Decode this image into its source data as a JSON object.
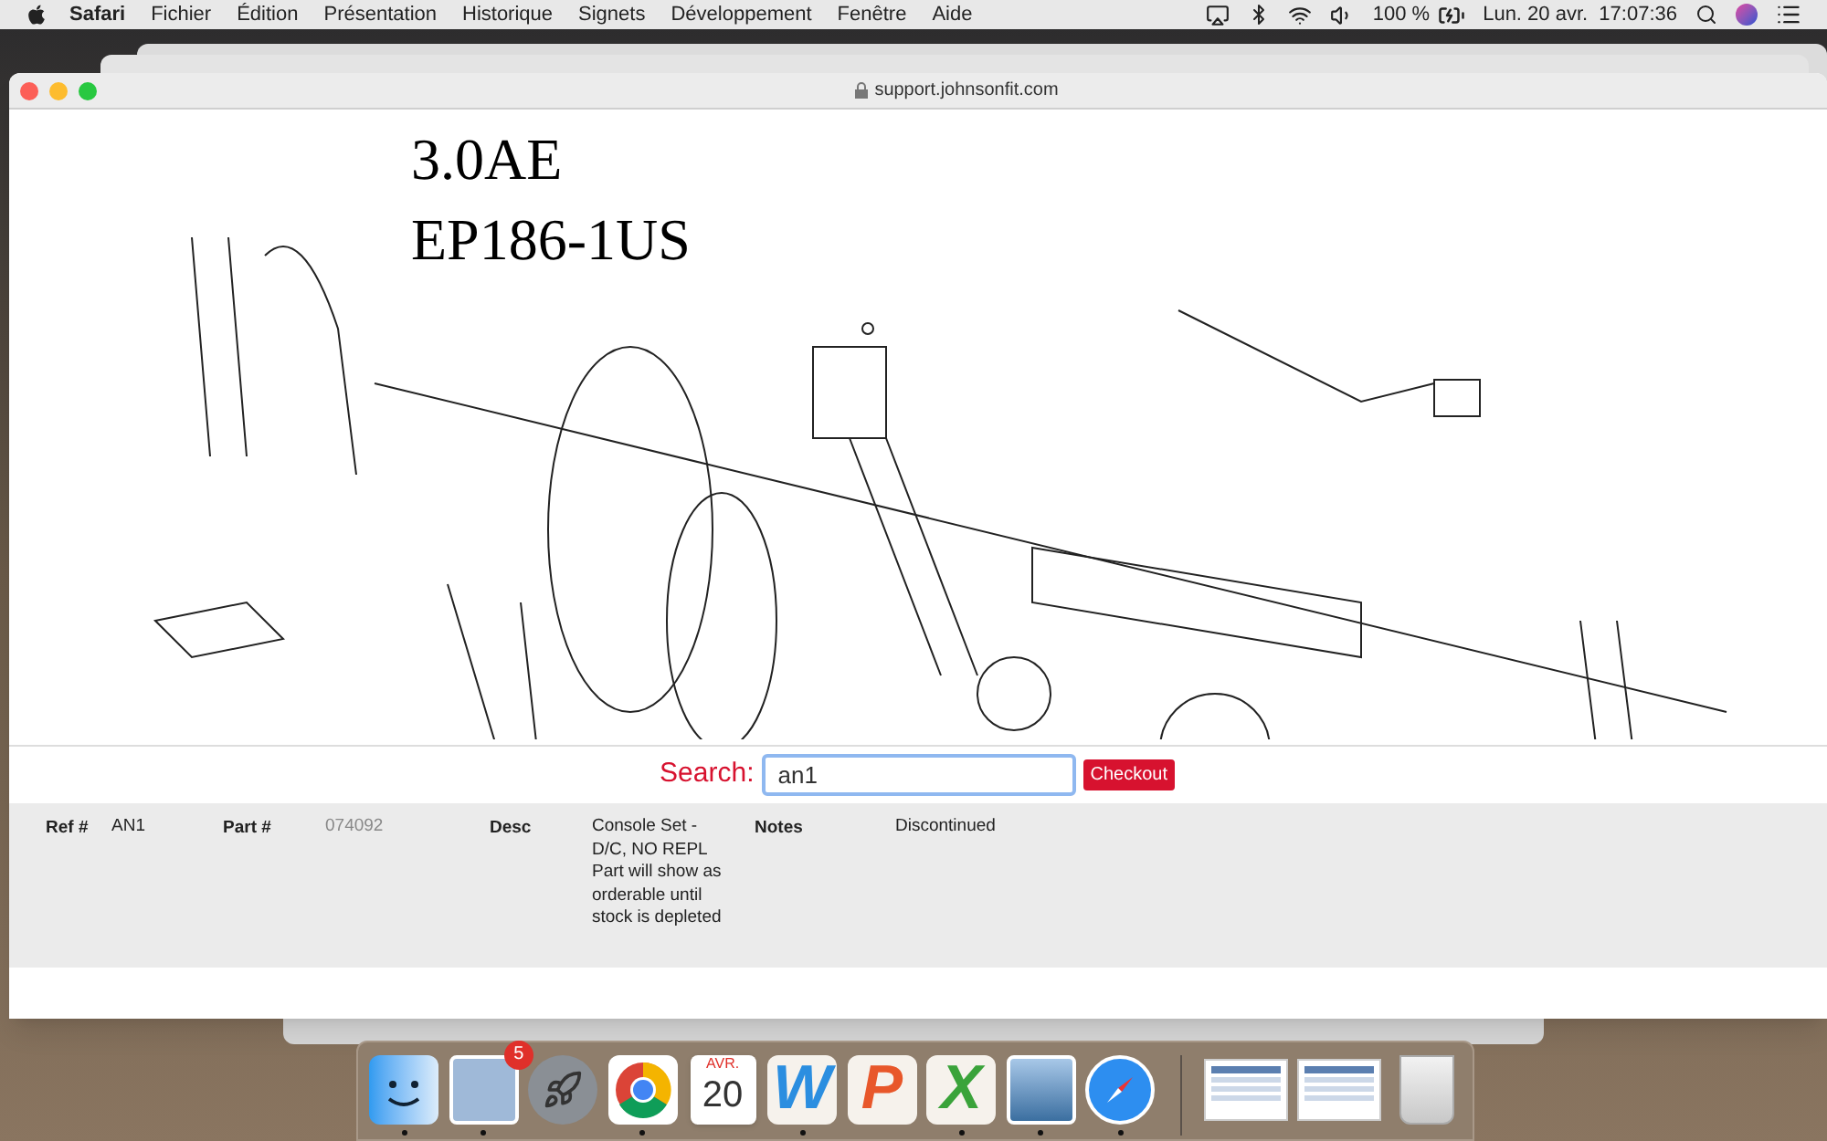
{
  "menu_bar": {
    "app": "Safari",
    "menus": [
      "Fichier",
      "Édition",
      "Présentation",
      "Historique",
      "Signets",
      "Développement",
      "Fenêtre",
      "Aide"
    ],
    "battery": "100 %",
    "clock": "Lun. 20 avr.  17:07:36"
  },
  "browser": {
    "url": "support.johnsonfit.com"
  },
  "diagram": {
    "title": "3.0AE",
    "model": "EP186-1US"
  },
  "search": {
    "label": "Search:",
    "value": "an1",
    "button": "Checkout"
  },
  "result": [
    {
      "label": "Ref #",
      "value": "AN1",
      "muted": false
    },
    {
      "label": "Part #",
      "value": "074092",
      "muted": true
    },
    {
      "label": "Desc",
      "value": "Console Set - D/C, NO REPL Part will show as orderable until stock is depleted",
      "muted": false
    },
    {
      "label": "Notes",
      "value": "Discontinued",
      "muted": false
    }
  ],
  "dock": [
    {
      "kind": "finder",
      "running": true
    },
    {
      "kind": "mail",
      "running": true,
      "badge": "5"
    },
    {
      "kind": "launchpad",
      "running": false
    },
    {
      "kind": "chrome",
      "running": true
    },
    {
      "kind": "calendar",
      "running": false,
      "month": "AVR.",
      "day": "20"
    },
    {
      "kind": "letter",
      "running": true,
      "letter": "W",
      "color": "#2b8ee0"
    },
    {
      "kind": "letter",
      "running": false,
      "letter": "P",
      "color": "#e8572a"
    },
    {
      "kind": "letter",
      "running": true,
      "letter": "X",
      "color": "#3aa33a"
    },
    {
      "kind": "preview",
      "running": true
    },
    {
      "kind": "safari",
      "running": true
    },
    {
      "kind": "separator"
    },
    {
      "kind": "document",
      "running": false
    },
    {
      "kind": "document",
      "running": false
    },
    {
      "kind": "trash",
      "running": false
    }
  ]
}
